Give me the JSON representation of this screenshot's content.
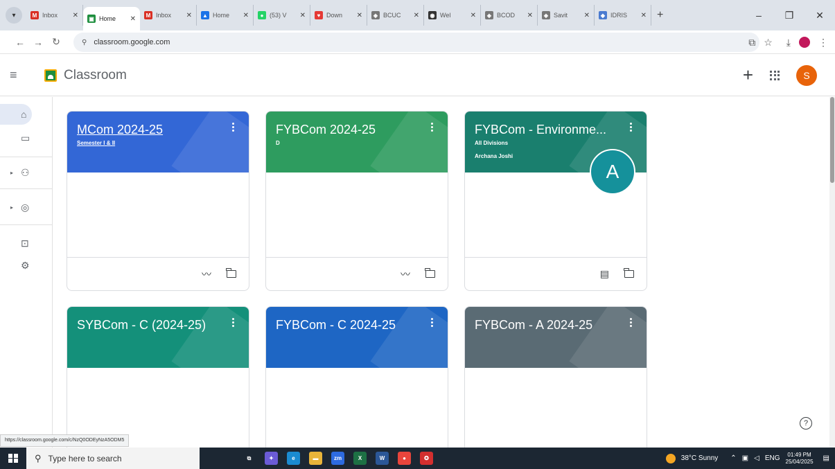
{
  "browser": {
    "tabs": [
      {
        "title": "Inbox",
        "favicon": "gmail-icon",
        "color": "#d93025",
        "glyph": "M"
      },
      {
        "title": "Home",
        "favicon": "classroom-icon",
        "color": "#1e8e3e",
        "glyph": "▣",
        "active": true
      },
      {
        "title": "Inbox",
        "favicon": "gmail-icon",
        "color": "#d93025",
        "glyph": "M"
      },
      {
        "title": "Home",
        "favicon": "drive-icon",
        "color": "#1a73e8",
        "glyph": "▲"
      },
      {
        "title": "(53) V",
        "favicon": "whatsapp-icon",
        "color": "#25d366",
        "glyph": "●"
      },
      {
        "title": "Down",
        "favicon": "download-site-icon",
        "color": "#e53935",
        "glyph": "♥"
      },
      {
        "title": "BCUC",
        "favicon": "college-icon",
        "color": "#777",
        "glyph": "◈"
      },
      {
        "title": "Wel",
        "favicon": "globe-icon",
        "color": "#333",
        "glyph": "◉"
      },
      {
        "title": "BCOD",
        "favicon": "college-icon",
        "color": "#777",
        "glyph": "◈"
      },
      {
        "title": "Savit",
        "favicon": "college-icon",
        "color": "#777",
        "glyph": "◈"
      },
      {
        "title": "IDRIS",
        "favicon": "idris-icon",
        "color": "#4a7bd0",
        "glyph": "◆"
      }
    ],
    "new_tab": "+",
    "url": "classroom.google.com",
    "status_url": "https://classroom.google.com/c/NzQ0ODEyNzA5ODM5"
  },
  "app": {
    "title": "Classroom",
    "avatar_letter": "S",
    "avatar_color": "#e8630a"
  },
  "rail": [
    "home-icon",
    "calendar-icon",
    "people-icon",
    "enrolled-icon",
    "archive-icon",
    "settings-icon"
  ],
  "cards": [
    {
      "title": "MCom 2024-25",
      "subtitle": "Semester I & II",
      "subtitle2": "",
      "color": "#3367d6",
      "underlined": true,
      "footer": [
        "trend-icon",
        "folder-icon"
      ]
    },
    {
      "title": "FYBCom 2024-25",
      "subtitle": "D",
      "subtitle2": "",
      "color": "#2e9c5f",
      "underlined": false,
      "footer": [
        "trend-icon",
        "folder-icon"
      ]
    },
    {
      "title": "FYBCom - Environme...",
      "subtitle": "All Divisions",
      "subtitle2": "Archana Joshi",
      "color": "#1a7f6e",
      "underlined": false,
      "badge": "A",
      "footer": [
        "assignment-icon",
        "folder-icon"
      ]
    },
    {
      "title": "SYBCom - C (2024-25)",
      "subtitle": "",
      "subtitle2": "",
      "color": "#14907a",
      "underlined": false,
      "footer": []
    },
    {
      "title": "FYBCom - C 2024-25",
      "subtitle": "",
      "subtitle2": "",
      "color": "#1e66c4",
      "underlined": false,
      "footer": []
    },
    {
      "title": "FYBCom - A 2024-25",
      "subtitle": "",
      "subtitle2": "",
      "color": "#5a6b74",
      "underlined": false,
      "footer": []
    }
  ],
  "taskbar": {
    "search_placeholder": "Type here to search",
    "weather": "38°C  Sunny",
    "lang": "ENG",
    "time": "01:49 PM",
    "date": "25/04/2025",
    "apps": [
      {
        "name": "task-view-icon",
        "glyph": "⧉",
        "color": "transparent"
      },
      {
        "name": "copilot-icon",
        "glyph": "✦",
        "color": "#6b5bd6"
      },
      {
        "name": "edge-icon",
        "glyph": "e",
        "color": "#1b8bd1"
      },
      {
        "name": "file-explorer-icon",
        "glyph": "▬",
        "color": "#e8b43a"
      },
      {
        "name": "zoom-icon",
        "glyph": "zm",
        "color": "#2d6be0"
      },
      {
        "name": "excel-icon",
        "glyph": "X",
        "color": "#1d7044"
      },
      {
        "name": "word-icon",
        "glyph": "W",
        "color": "#2b5797"
      },
      {
        "name": "chrome-icon",
        "glyph": "●",
        "color": "#e8453c"
      },
      {
        "name": "app-icon",
        "glyph": "✪",
        "color": "#d32f2f"
      }
    ]
  }
}
